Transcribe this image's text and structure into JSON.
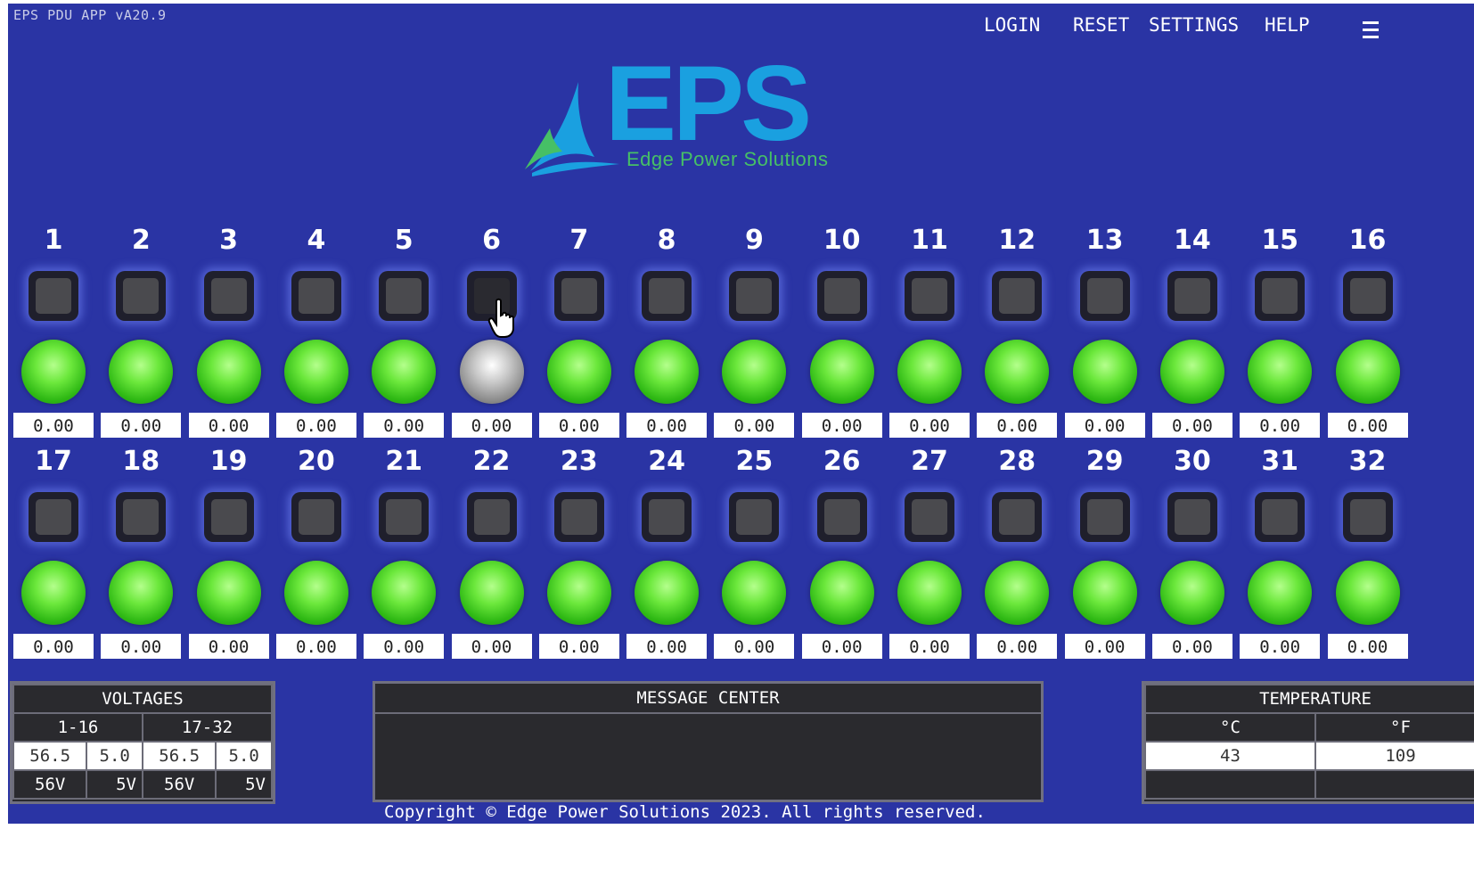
{
  "app": {
    "version": "EPS PDU APP vA20.9"
  },
  "nav": {
    "login": "LOGIN",
    "reset": "RESET",
    "settings": "SETTINGS",
    "help": "HELP"
  },
  "logo": {
    "letters": "EPS",
    "tagline": "Edge Power Solutions"
  },
  "outlets": [
    {
      "num": "1",
      "led": "on",
      "value": "0.00"
    },
    {
      "num": "2",
      "led": "on",
      "value": "0.00"
    },
    {
      "num": "3",
      "led": "on",
      "value": "0.00"
    },
    {
      "num": "4",
      "led": "on",
      "value": "0.00"
    },
    {
      "num": "5",
      "led": "on",
      "value": "0.00"
    },
    {
      "num": "6",
      "led": "off",
      "value": "0.00"
    },
    {
      "num": "7",
      "led": "on",
      "value": "0.00"
    },
    {
      "num": "8",
      "led": "on",
      "value": "0.00"
    },
    {
      "num": "9",
      "led": "on",
      "value": "0.00"
    },
    {
      "num": "10",
      "led": "on",
      "value": "0.00"
    },
    {
      "num": "11",
      "led": "on",
      "value": "0.00"
    },
    {
      "num": "12",
      "led": "on",
      "value": "0.00"
    },
    {
      "num": "13",
      "led": "on",
      "value": "0.00"
    },
    {
      "num": "14",
      "led": "on",
      "value": "0.00"
    },
    {
      "num": "15",
      "led": "on",
      "value": "0.00"
    },
    {
      "num": "16",
      "led": "on",
      "value": "0.00"
    },
    {
      "num": "17",
      "led": "on",
      "value": "0.00"
    },
    {
      "num": "18",
      "led": "on",
      "value": "0.00"
    },
    {
      "num": "19",
      "led": "on",
      "value": "0.00"
    },
    {
      "num": "20",
      "led": "on",
      "value": "0.00"
    },
    {
      "num": "21",
      "led": "on",
      "value": "0.00"
    },
    {
      "num": "22",
      "led": "on",
      "value": "0.00"
    },
    {
      "num": "23",
      "led": "on",
      "value": "0.00"
    },
    {
      "num": "24",
      "led": "on",
      "value": "0.00"
    },
    {
      "num": "25",
      "led": "on",
      "value": "0.00"
    },
    {
      "num": "26",
      "led": "on",
      "value": "0.00"
    },
    {
      "num": "27",
      "led": "on",
      "value": "0.00"
    },
    {
      "num": "28",
      "led": "on",
      "value": "0.00"
    },
    {
      "num": "29",
      "led": "on",
      "value": "0.00"
    },
    {
      "num": "30",
      "led": "on",
      "value": "0.00"
    },
    {
      "num": "31",
      "led": "on",
      "value": "0.00"
    },
    {
      "num": "32",
      "led": "on",
      "value": "0.00"
    }
  ],
  "voltages": {
    "title": "VOLTAGES",
    "groups": [
      "1-16",
      "17-32"
    ],
    "readings": [
      "56.5",
      "5.0",
      "56.5",
      "5.0"
    ],
    "nominal": [
      "56V",
      "5V",
      "56V",
      "5V"
    ]
  },
  "message_center": {
    "title": "MESSAGE CENTER"
  },
  "temperature": {
    "title": "TEMPERATURE",
    "unit_c": "°C",
    "unit_f": "°F",
    "value_c": "43",
    "value_f": "109"
  },
  "footer": {
    "copyright": "Copyright © Edge Power Solutions 2023. All rights reserved."
  },
  "colors": {
    "background": "#2a34a4",
    "led_on": "#3cd020",
    "led_off": "#a0a0a0",
    "logo_blue": "#1aa0e0",
    "logo_green": "#46c066"
  }
}
